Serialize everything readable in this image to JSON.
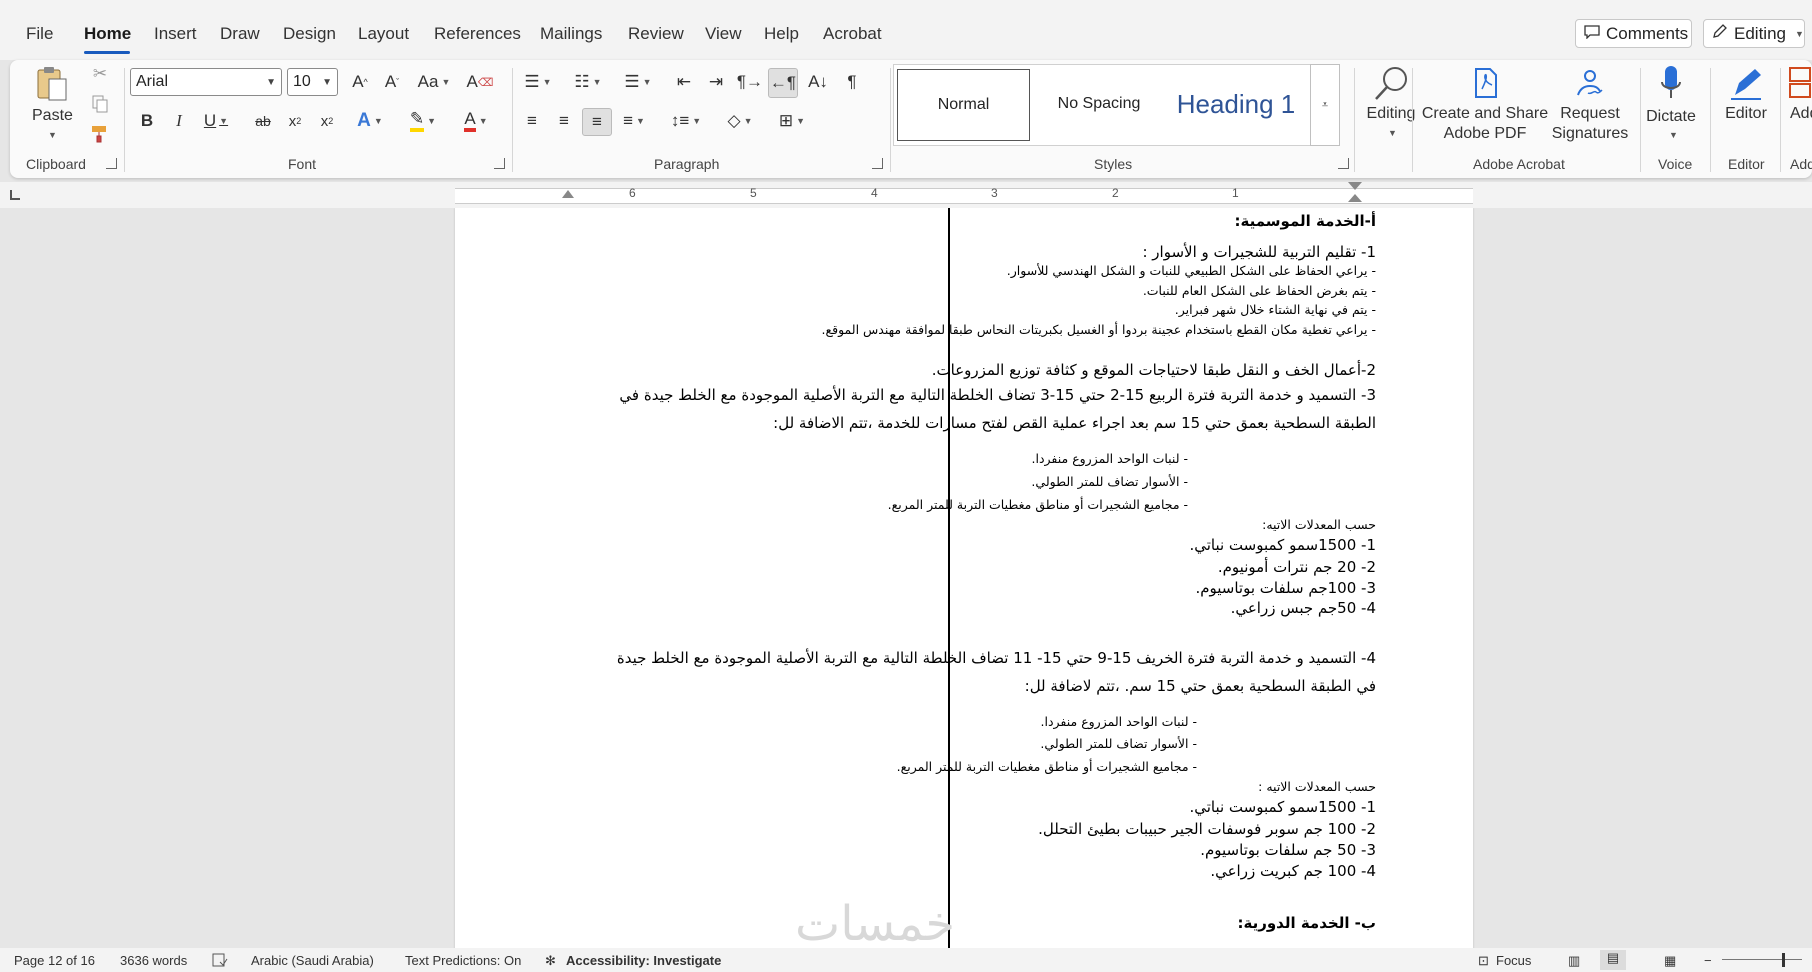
{
  "menu": {
    "tabs": [
      "File",
      "Home",
      "Insert",
      "Draw",
      "Design",
      "Layout",
      "References",
      "Mailings",
      "Review",
      "View",
      "Help",
      "Acrobat"
    ],
    "active": "Home",
    "comments_label": "Comments",
    "editing_label": "Editing"
  },
  "ribbon": {
    "clipboard": {
      "paste_label": "Paste",
      "group_label": "Clipboard"
    },
    "font": {
      "font_name": "Arial",
      "font_size": "10",
      "group_label": "Font"
    },
    "paragraph": {
      "group_label": "Paragraph"
    },
    "styles": {
      "items": [
        "Normal",
        "No Spacing",
        "Heading 1"
      ],
      "group_label": "Styles"
    },
    "editing": {
      "label": "Editing"
    },
    "acrobat": {
      "create_share_label": "Create and Share",
      "create_share_label2": "Adobe PDF",
      "request_label": "Request",
      "request_label2": "Signatures",
      "group_label": "Adobe Acrobat"
    },
    "voice": {
      "dictate_label": "Dictate",
      "group_label": "Voice"
    },
    "editor": {
      "label": "Editor",
      "group_label": "Editor"
    },
    "addins": {
      "label": "Add",
      "group_label": "Add-"
    }
  },
  "ruler": {
    "numbers": [
      "6",
      "5",
      "4",
      "3",
      "2",
      "1"
    ]
  },
  "document": {
    "lines": [
      "أ-الخدمة الموسمية:",
      "1- تقليم التربية للشجيرات و الأسوار :",
      "- يراعي الحفاظ على الشكل الطبيعي للنبات و الشكل الهندسي للأسوار.",
      "- يتم بغرض الحفاظ على الشكل العام للنبات.",
      "- يتم في نهاية الشتاء خلال شهر فبراير.",
      "- يراعي تغطية مكان القطع باستخدام عجينة بردوا أو الغسيل بكبريتات النحاس طبقا لموافقة مهندس الموقع.",
      "2-أعمال الخف و النقل طبقا لاحتياجات الموقع و كثافة توزيع المزروعات.",
      "3- التسميد و خدمة التربة فترة الربيع 15-2 حتي 15-3 تضاف الخلطة التالية مع التربة الأصلية الموجودة مع الخلط جيدة في",
      "الطبقة السطحية بعمق حتي 15 سم بعد اجراء عملية القص لفتح مسارات للخدمة ،تتم الاضافة لل:",
      "- لنبات الواحد المزروع منفردا.",
      "- الأسوار تضاف للمتر الطولي.",
      "- مجاميع الشجيرات أو مناطق مغطيات التربة للمتر المربع.",
      "حسب المعدلات الاتيه:",
      "1- 1500سمو كمبوست نباتي.",
      "2- 20 جم نترات أمونيوم.",
      "3- 100جم سلفات بوتاسيوم.",
      "4- 50جم جبس زراعي.",
      "4- التسميد و خدمة التربة فترة الخريف 15-9 حتي 15- 11 تضاف الخلطة التالية مع التربة الأصلية الموجودة مع الخلط جيدة",
      "في الطبقة السطحية بعمق حتي 15 سم. ،تتم لاضافة لل:",
      "- لنبات الواحد المزروع منفردا.",
      "- الأسوار تضاف للمتر الطولي.",
      "- مجاميع الشجيرات أو مناطق مغطيات التربة للمتر المربع.",
      "حسب المعدلات الاتيه :",
      "1- 1500سمو كمبوست نباتي.",
      "2- 100 جم سوبر فوسفات الجير حبيبات بطيئ التحلل.",
      "3- 50 جم سلفات بوتاسيوم.",
      "4- 100 جم كبريت زراعي.",
      "ب- الخدمة الدورية:"
    ],
    "watermark": "خمسات"
  },
  "status": {
    "page": "Page 12 of 16",
    "words": "3636 words",
    "language": "Arabic (Saudi Arabia)",
    "predictions": "Text Predictions: On",
    "accessibility": "Accessibility: Investigate",
    "focus": "Focus"
  },
  "colors": {
    "accent": "#185abd",
    "highlight": "#ffd700",
    "font_color": "#e0312a"
  }
}
